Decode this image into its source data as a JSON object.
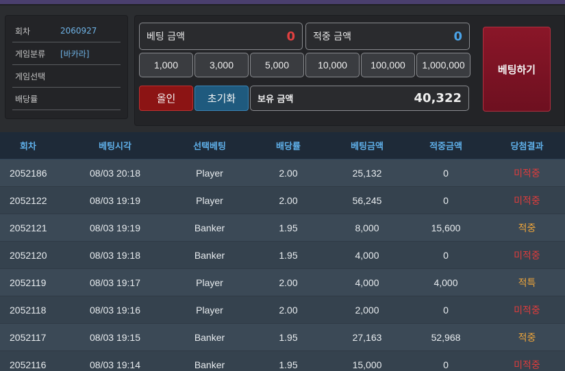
{
  "info": {
    "rows": [
      {
        "label": "회차",
        "value": "2060927"
      },
      {
        "label": "게임분류",
        "value": "[바카라]"
      },
      {
        "label": "게임선택",
        "value": ""
      },
      {
        "label": "배당률",
        "value": ""
      }
    ]
  },
  "bet": {
    "bet_amount_label": "베팅 금액",
    "bet_amount_value": "0",
    "win_amount_label": "적중 금액",
    "win_amount_value": "0",
    "chips": [
      "1,000",
      "3,000",
      "5,000",
      "10,000",
      "100,000",
      "1,000,000"
    ],
    "allin_label": "올인",
    "reset_label": "초기화",
    "balance_label": "보유 금액",
    "balance_value": "40,322",
    "submit_label": "베팅하기"
  },
  "history": {
    "headers": [
      "회차",
      "베팅시각",
      "선택베팅",
      "배당률",
      "베팅금액",
      "적중금액",
      "당첨결과"
    ],
    "rows": [
      [
        "2052186",
        "08/03 20:18",
        "Player",
        "2.00",
        "25,132",
        "0",
        "미적중"
      ],
      [
        "2052122",
        "08/03 19:19",
        "Player",
        "2.00",
        "56,245",
        "0",
        "미적중"
      ],
      [
        "2052121",
        "08/03 19:19",
        "Banker",
        "1.95",
        "8,000",
        "15,600",
        "적중"
      ],
      [
        "2052120",
        "08/03 19:18",
        "Banker",
        "1.95",
        "4,000",
        "0",
        "미적중"
      ],
      [
        "2052119",
        "08/03 19:17",
        "Player",
        "2.00",
        "4,000",
        "4,000",
        "적특"
      ],
      [
        "2052118",
        "08/03 19:16",
        "Player",
        "2.00",
        "2,000",
        "0",
        "미적중"
      ],
      [
        "2052117",
        "08/03 19:15",
        "Banker",
        "1.95",
        "27,163",
        "52,968",
        "적중"
      ],
      [
        "2052116",
        "08/03 19:14",
        "Banker",
        "1.95",
        "15,000",
        "0",
        "미적중"
      ]
    ]
  },
  "colors": {
    "miss": "#e03c3c",
    "hit": "#f0a63a",
    "accent_blue": "#5fb0ea"
  }
}
